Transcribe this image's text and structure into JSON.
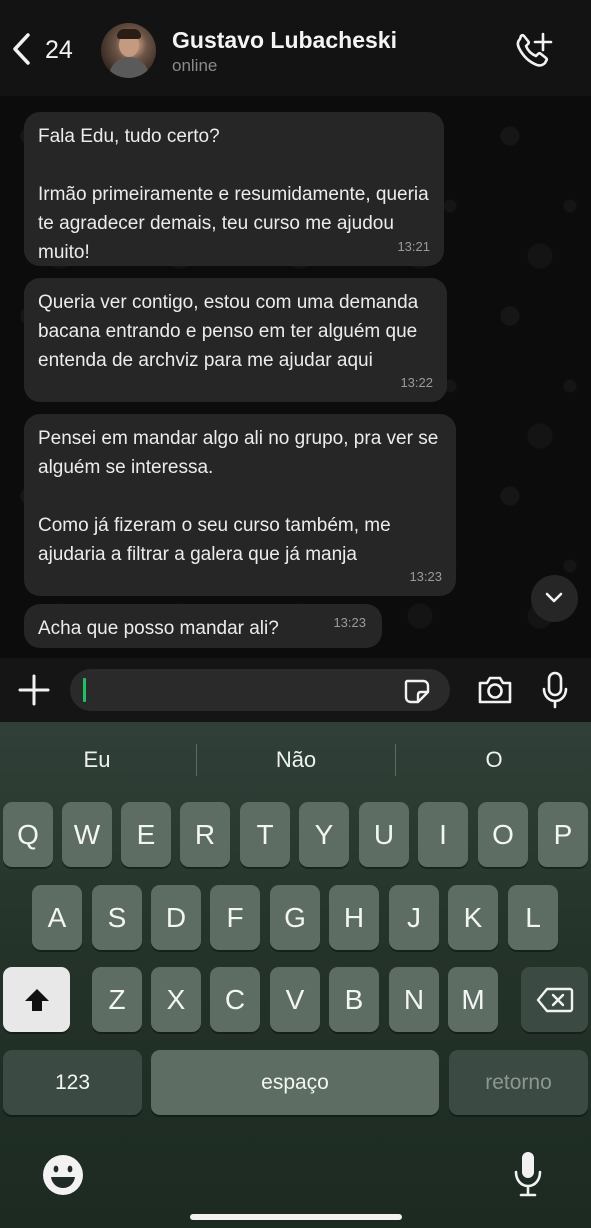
{
  "header": {
    "back_count": "24",
    "contact_name": "Gustavo Lubacheski",
    "contact_status": "online"
  },
  "messages": [
    {
      "text": "Fala Edu, tudo certo?\n\nIrmão primeiramente e resumidamente, queria te agradecer demais, teu curso me ajudou muito!",
      "time": "13:21"
    },
    {
      "text": "Queria ver contigo, estou com uma demanda bacana entrando e penso em ter alguém que entenda de archviz para me ajudar aqui",
      "time": "13:22"
    },
    {
      "text": "Pensei em mandar algo ali no grupo, pra ver se alguém se interessa.\n\nComo já fizeram o seu curso também, me ajudaria a filtrar a galera que já manja",
      "time": "13:23"
    },
    {
      "text": "Acha que posso mandar ali?",
      "time": "13:23"
    }
  ],
  "composer": {
    "value": ""
  },
  "keyboard": {
    "suggestions": [
      "Eu",
      "Não",
      "O"
    ],
    "row1": [
      "Q",
      "W",
      "E",
      "R",
      "T",
      "Y",
      "U",
      "I",
      "O",
      "P"
    ],
    "row2": [
      "A",
      "S",
      "D",
      "F",
      "G",
      "H",
      "J",
      "K",
      "L"
    ],
    "row3": [
      "Z",
      "X",
      "C",
      "V",
      "B",
      "N",
      "M"
    ],
    "numbers_key": "123",
    "space_key": "espaço",
    "return_key": "retorno"
  },
  "colors": {
    "bubble": "#262626",
    "cursor_accent": "#21c063",
    "keyboard_bg": "#243329"
  },
  "icons": [
    "chevron-left-icon",
    "add-call-icon",
    "chevron-down-icon",
    "plus-icon",
    "sticker-icon",
    "camera-icon",
    "microphone-icon",
    "shift-icon",
    "backspace-icon",
    "emoji-icon"
  ]
}
